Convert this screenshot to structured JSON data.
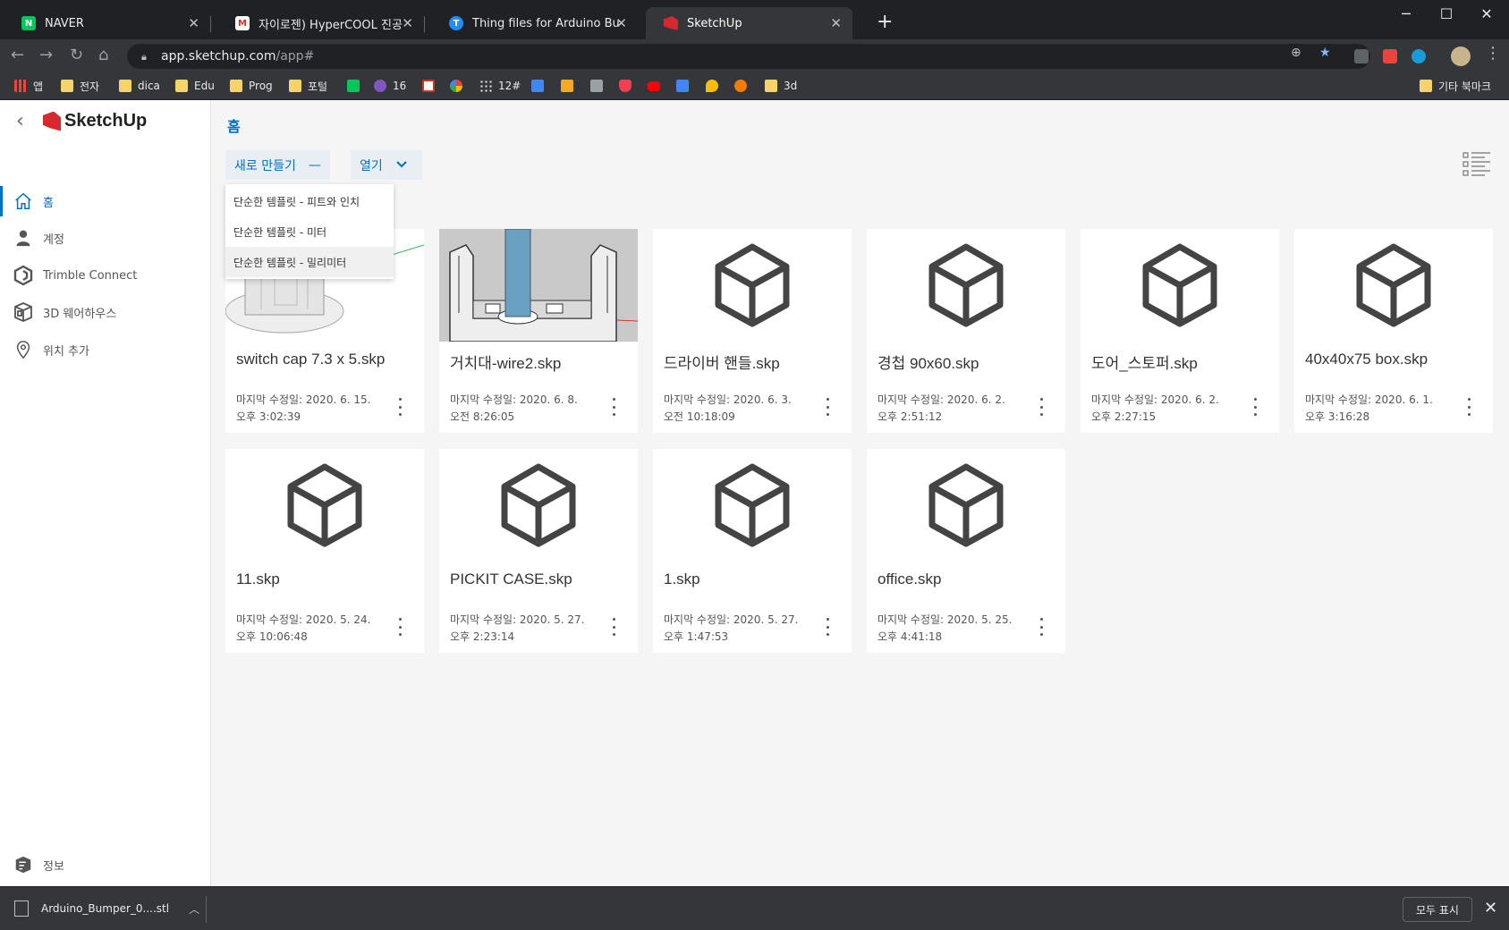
{
  "browser": {
    "tabs": [
      {
        "title": "NAVER",
        "favicon": "naver-icon",
        "color": "#03c75a"
      },
      {
        "title": "자이로젠) HyperCOOL 진공 센서",
        "favicon": "gmail-icon",
        "color": "#d93025"
      },
      {
        "title": "Thing files for Arduino Bumper",
        "favicon": "thingiverse-icon",
        "color": "#248bfb"
      },
      {
        "title": "SketchUp",
        "favicon": "sketchup-icon",
        "color": "#d5282f"
      }
    ],
    "new_tab": "+",
    "url_host": "app.sketchup.com",
    "url_path": "/app#",
    "bookmarks": [
      {
        "label": "앱",
        "icon": "apps-icon"
      },
      {
        "label": "전자",
        "icon": "folder-icon"
      },
      {
        "label": "dica",
        "icon": "folder-icon"
      },
      {
        "label": "Edu",
        "icon": "folder-icon"
      },
      {
        "label": "Prog",
        "icon": "folder-icon"
      },
      {
        "label": "포털",
        "icon": "folder-icon"
      },
      {
        "label": "",
        "icon": "naver-icon"
      },
      {
        "label": "16",
        "icon": "d-icon"
      },
      {
        "label": "",
        "icon": "gmail-icon"
      },
      {
        "label": "",
        "icon": "photos-icon"
      },
      {
        "label": "12#",
        "icon": "dots-icon"
      },
      {
        "label": "",
        "icon": "calendar-icon"
      },
      {
        "label": "",
        "icon": "r-icon"
      },
      {
        "label": "",
        "icon": "print-icon"
      },
      {
        "label": "",
        "icon": "pocket-icon"
      },
      {
        "label": "",
        "icon": "youtube-icon"
      },
      {
        "label": "",
        "icon": "translate-icon"
      },
      {
        "label": "",
        "icon": "maps-icon"
      },
      {
        "label": "",
        "icon": "swirl-icon"
      },
      {
        "label": "3d",
        "icon": "folder-icon"
      }
    ],
    "other_bookmarks": "기타 북마크"
  },
  "sidebar": {
    "logo": "SketchUp",
    "items": [
      {
        "label": "홈",
        "icon": "home-icon",
        "active": true
      },
      {
        "label": "계정",
        "icon": "person-icon"
      },
      {
        "label": "Trimble Connect",
        "icon": "trimble-connect-icon"
      },
      {
        "label": "3D 웨어하우스",
        "icon": "warehouse-icon"
      },
      {
        "label": "위치 추가",
        "icon": "location-pin-icon"
      }
    ],
    "info": "정보"
  },
  "main": {
    "breadcrumb": "홈",
    "new_button": "새로 만들기",
    "open_button": "열기",
    "new_menu": [
      "단순한 템플릿 - 피트와 인치",
      "단순한 템플릿 - 미터",
      "단순한 템플릿 - 밀리미터"
    ],
    "files": [
      {
        "name": "switch cap 7.3 x 5.skp",
        "date": "마지막 수정일: 2020. 6. 15.",
        "time": "오후 3:02:39",
        "thumb": "switch-cap"
      },
      {
        "name": "거치대-wire2.skp",
        "date": "마지막 수정일: 2020. 6. 8.",
        "time": "오전 8:26:05",
        "thumb": "stand"
      },
      {
        "name": "드라이버 핸들.skp",
        "date": "마지막 수정일: 2020. 6. 3.",
        "time": "오전 10:18:09",
        "thumb": "cube"
      },
      {
        "name": "경첩 90x60.skp",
        "date": "마지막 수정일: 2020. 6. 2.",
        "time": "오후 2:51:12",
        "thumb": "cube"
      },
      {
        "name": "도어_스토퍼.skp",
        "date": "마지막 수정일: 2020. 6. 2.",
        "time": "오후 2:27:15",
        "thumb": "cube"
      },
      {
        "name": "40x40x75 box.skp",
        "date": "마지막 수정일: 2020. 6. 1.",
        "time": "오후 3:16:28",
        "thumb": "cube"
      },
      {
        "name": "11.skp",
        "date": "마지막 수정일: 2020. 5. 24.",
        "time": "오후 10:06:48",
        "thumb": "cube"
      },
      {
        "name": "PICKIT CASE.skp",
        "date": "마지막 수정일: 2020. 5. 27.",
        "time": "오후 2:23:14",
        "thumb": "cube"
      },
      {
        "name": "1.skp",
        "date": "마지막 수정일: 2020. 5. 27.",
        "time": "오후 1:47:53",
        "thumb": "cube"
      },
      {
        "name": "office.skp",
        "date": "마지막 수정일: 2020. 5. 25.",
        "time": "오후 4:41:18",
        "thumb": "cube"
      }
    ]
  },
  "downloads": {
    "file": "Arduino_Bumper_0....stl",
    "show_all": "모두 표시"
  }
}
